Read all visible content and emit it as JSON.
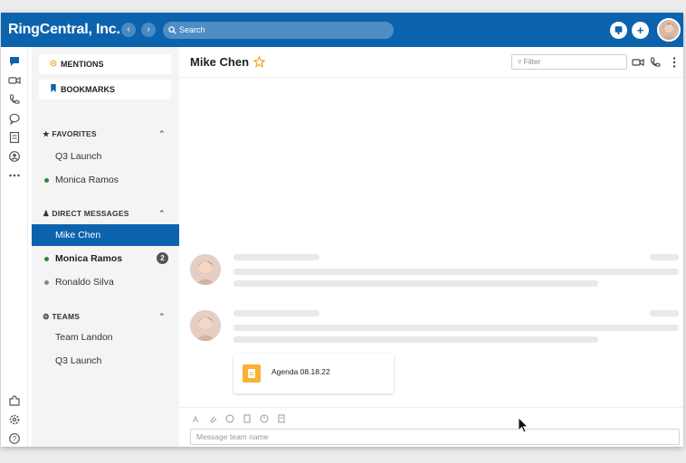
{
  "app": {
    "brand": "RingCentral, Inc.",
    "search_placeholder": "Search"
  },
  "sidebar": {
    "mentions": "MENTIONS",
    "bookmarks": "BOOKMARKS",
    "favorites": {
      "label": "FAVORITES",
      "items": [
        {
          "label": "Q3 Launch",
          "status": "none"
        },
        {
          "label": "Monica Ramos",
          "status": "online"
        }
      ]
    },
    "direct_messages": {
      "label": "DIRECT MESSAGES",
      "items": [
        {
          "label": "Mike Chen",
          "selected": true
        },
        {
          "label": "Monica Ramos",
          "status": "online",
          "unread": "2"
        },
        {
          "label": "Ronaldo Silva",
          "status": "offline"
        }
      ]
    },
    "teams": {
      "label": "TEAMS",
      "items": [
        {
          "label": "Team Landon"
        },
        {
          "label": "Q3 Launch"
        }
      ]
    }
  },
  "conversation": {
    "title": "Mike Chen",
    "filter_placeholder": "Filter",
    "attachment_name": "Agenda 08.18.22",
    "input_placeholder": "Message team name"
  },
  "colors": {
    "brand_blue": "#0b63ae",
    "online": "#1e8e3e",
    "offline": "#888888",
    "star": "#f5a623",
    "file": "#f9b233"
  },
  "icons": [
    "message-icon",
    "video-icon",
    "phone-icon",
    "chat-icon",
    "notes-icon",
    "contacts-icon",
    "more-icon",
    "puzzle-icon",
    "settings-icon",
    "help-icon"
  ]
}
